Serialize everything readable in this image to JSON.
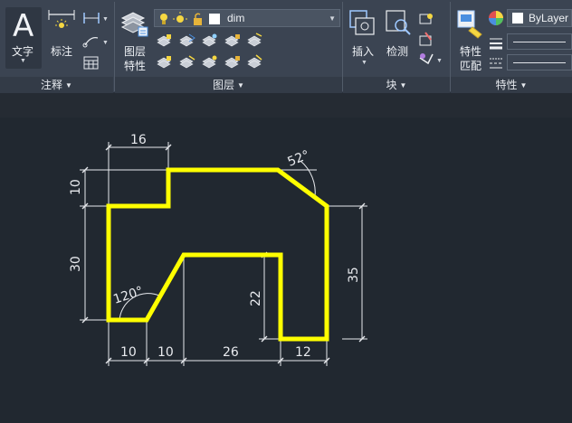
{
  "ribbon": {
    "annotation": {
      "text_label": "文字",
      "dimension_label": "标注",
      "panel_title": "注释"
    },
    "layers": {
      "properties_label_line1": "图层",
      "properties_label_line2": "特性",
      "current_layer": "dim",
      "panel_title": "图层"
    },
    "block": {
      "insert_label": "插入",
      "detect_label": "检测",
      "panel_title": "块"
    },
    "properties": {
      "match_label_line1": "特性",
      "match_label_line2": "匹配",
      "color_value": "ByLayer",
      "panel_title": "特性"
    }
  },
  "drawing": {
    "outline_color": "#ffff00",
    "dim_color": "#e8eaee",
    "dimensions": {
      "top_width": "16",
      "top_height": "10",
      "left_height": "30",
      "right_height": "35",
      "inner_height": "22",
      "bottom_1": "10",
      "bottom_2": "10",
      "bottom_3": "26",
      "bottom_4": "12",
      "angle_top": "52°",
      "angle_bottom": "120°"
    }
  }
}
